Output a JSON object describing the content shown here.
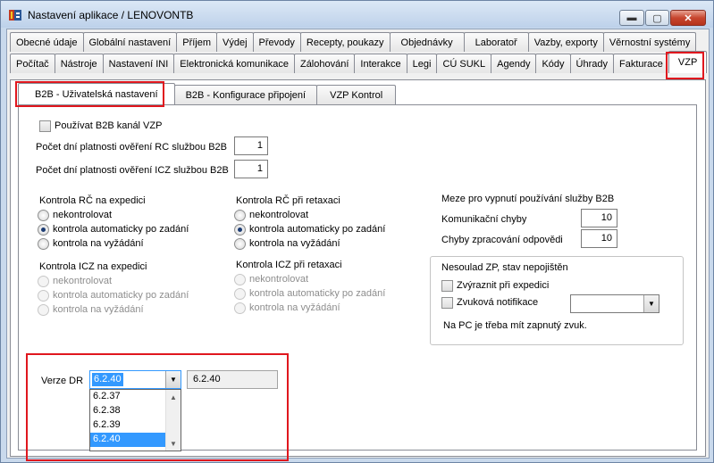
{
  "window": {
    "title": "Nastavení aplikace / LENOVONTB",
    "min_glyph": "▬",
    "max_glyph": "▢",
    "close_glyph": "✕"
  },
  "tabs_row1": [
    "Obecné údaje",
    "Globální nastavení",
    "Příjem",
    "Výdej",
    "Převody",
    "Recepty, poukazy",
    "Objednávky",
    "Laboratoř",
    "Vazby, exporty",
    "Věrnostní systémy"
  ],
  "tabs_row2": [
    "Počítač",
    "Nástroje",
    "Nastavení INI",
    "Elektronická komunikace",
    "Zálohování",
    "Interakce",
    "Legi",
    "CÚ SUKL",
    "Agendy",
    "Kódy",
    "Úhrady",
    "Fakturace",
    "VZP"
  ],
  "subtabs": [
    "B2B - Uživatelská nastavení",
    "B2B - Konfigurace připojení",
    "VZP Kontrol"
  ],
  "b2b": {
    "use_channel_label": "Používat B2B kanál VZP",
    "rc_days_label": "Počet dní platnosti ověření RC službou B2B",
    "rc_days_value": "1",
    "icz_days_label": "Počet dní platnosti ověření ICZ službou B2B",
    "icz_days_value": "1"
  },
  "rc_expedice": {
    "title": "Kontrola RČ na expedici",
    "options": [
      "nekontrolovat",
      "kontrola automaticky po zadání",
      "kontrola na vyžádání"
    ],
    "selected": 1
  },
  "rc_retaxace": {
    "title": "Kontrola RČ při retaxaci",
    "options": [
      "nekontrolovat",
      "kontrola automaticky po zadání",
      "kontrola na vyžádání"
    ],
    "selected": 1
  },
  "icz_expedice": {
    "title": "Kontrola ICZ na expedici",
    "options": [
      "nekontrolovat",
      "kontrola automaticky po zadání",
      "kontrola na vyžádání"
    ]
  },
  "icz_retaxace": {
    "title": "Kontrola ICZ při retaxaci",
    "options": [
      "nekontrolovat",
      "kontrola automaticky po zadání",
      "kontrola na vyžádání"
    ]
  },
  "limits": {
    "title": "Meze pro vypnutí používání služby B2B",
    "comm_errors_label": "Komunikační chyby",
    "comm_errors_value": "10",
    "proc_errors_label": "Chyby zpracování odpovědi",
    "proc_errors_value": "10"
  },
  "zp_mismatch": {
    "title": "Nesoulad ZP, stav nepojištěn",
    "highlight_label": "Zvýraznit při expedici",
    "sound_label": "Zvuková notifikace",
    "sound_value": "",
    "note": "Na PC je třeba mít zapnutý zvuk."
  },
  "dr_version": {
    "label": "Verze DR",
    "selected": "6.2.40",
    "current": "6.2.40",
    "options": [
      "6.2.37",
      "6.2.38",
      "6.2.39",
      "6.2.40"
    ]
  },
  "colors": {
    "highlight": "#e0171e",
    "selection": "#3399ff"
  }
}
